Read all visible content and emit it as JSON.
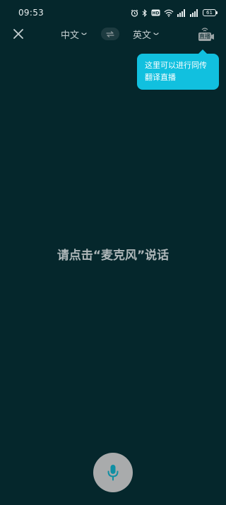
{
  "status_bar": {
    "time": "09:53",
    "battery": "61",
    "icons": [
      "alarm-icon",
      "bluetooth-icon",
      "hd-icon",
      "wifi-icon",
      "signal-icon",
      "signal-icon",
      "battery-icon"
    ]
  },
  "toolbar": {
    "close_icon": "close-icon",
    "source_lang": "中文",
    "target_lang": "英文",
    "swap_icon": "swap-icon",
    "live_label": "直播"
  },
  "tooltip": {
    "text": "这里可以进行同传翻译直播"
  },
  "main": {
    "prompt": "请点击“麦克风”说话"
  },
  "mic": {
    "icon": "microphone-icon"
  },
  "colors": {
    "background": "#05272c",
    "accent": "#11c0df",
    "mic_button": "#a9abac",
    "mic_icon": "#0f8fa3"
  }
}
